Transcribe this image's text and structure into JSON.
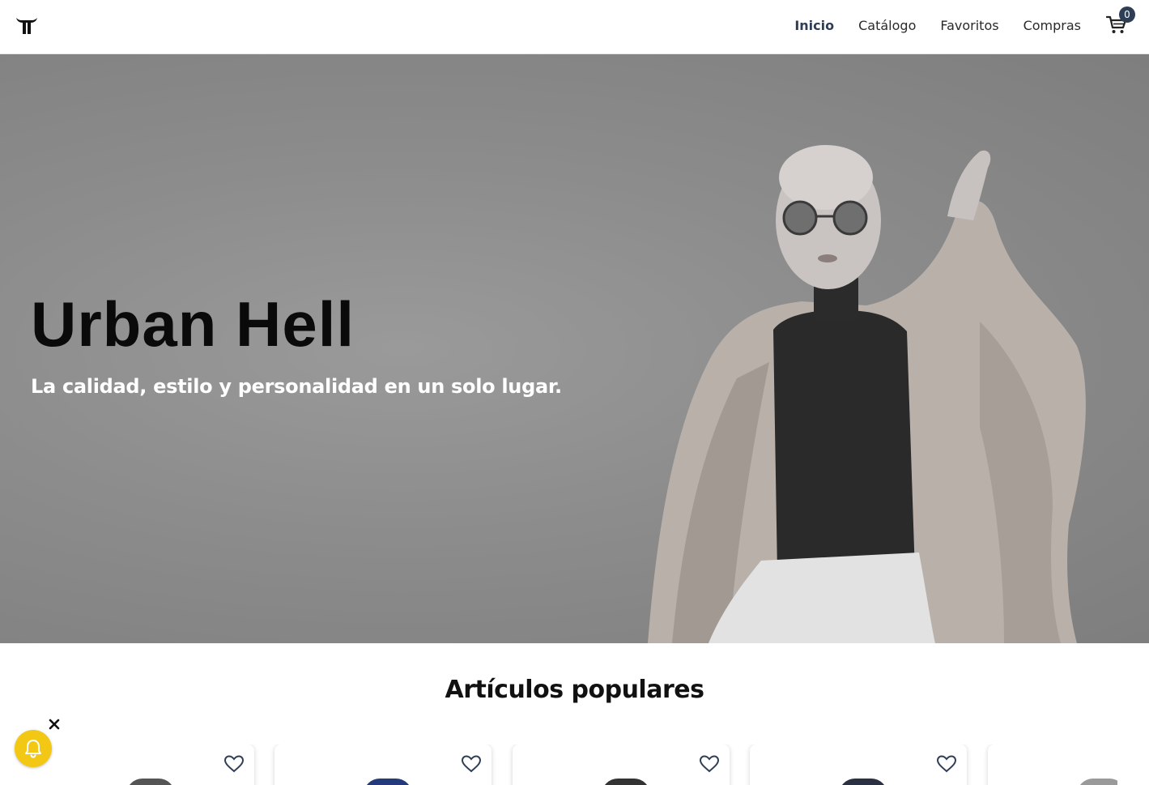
{
  "header": {
    "nav": [
      {
        "label": "Inicio",
        "active": true
      },
      {
        "label": "Catálogo",
        "active": false
      },
      {
        "label": "Favoritos",
        "active": false
      },
      {
        "label": "Compras",
        "active": false
      }
    ],
    "cart_count": "0"
  },
  "hero": {
    "title": "Urban Hell",
    "subtitle": "La calidad, estilo y personalidad en un solo lugar."
  },
  "popular": {
    "title": "Artículos populares",
    "items": [
      {
        "thumb_color": "#555555"
      },
      {
        "thumb_color": "#243a7a"
      },
      {
        "thumb_color": "#333333"
      },
      {
        "thumb_color": "#2a3142"
      },
      {
        "thumb_color": "#9a9a9a"
      }
    ]
  },
  "colors": {
    "accent": "#2f3d55",
    "bell": "#f2c815"
  }
}
